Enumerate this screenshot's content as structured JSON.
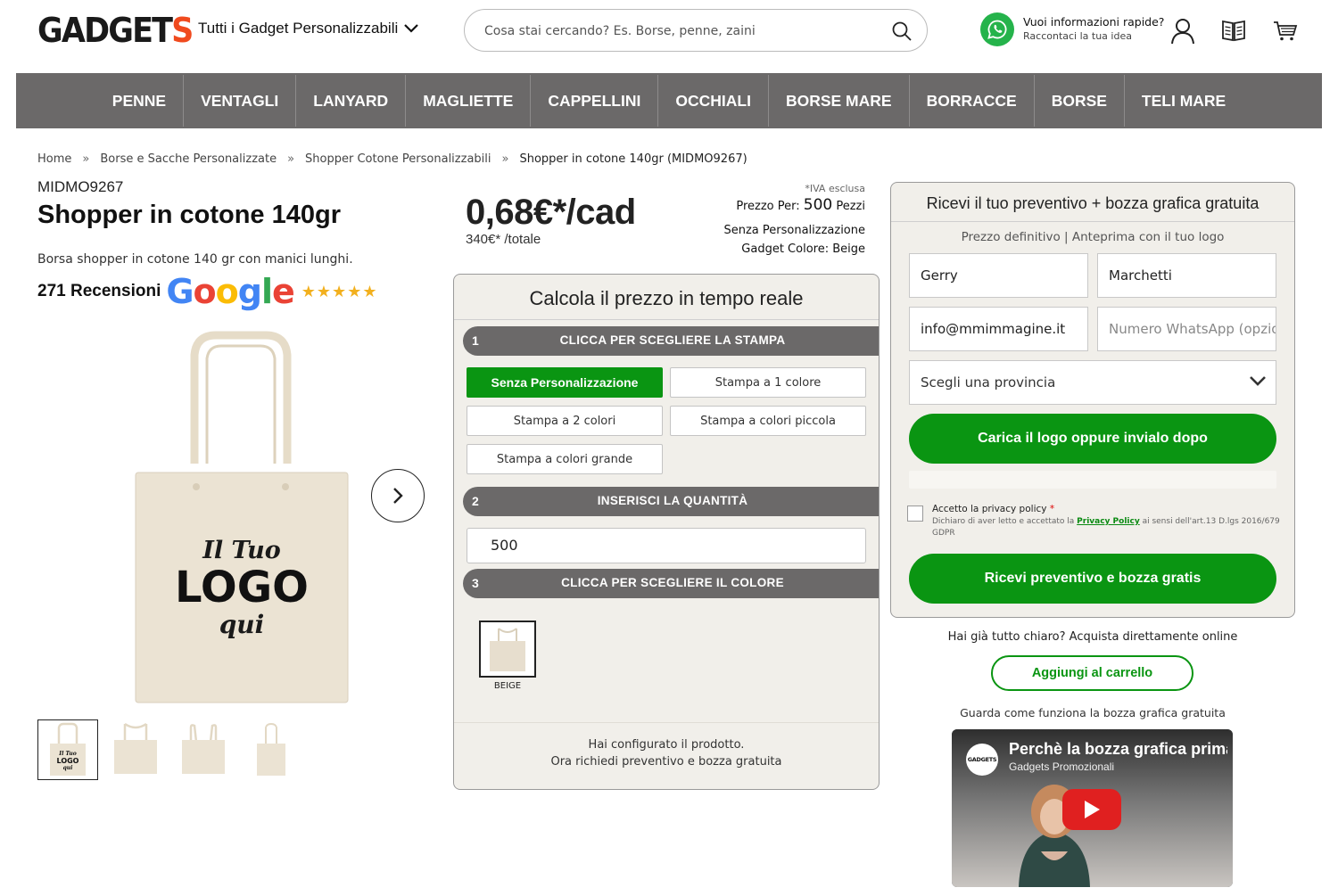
{
  "header": {
    "logo_main": "GADGET",
    "logo_accent": "S",
    "categories_label": "Tutti i Gadget Personalizzabili",
    "search_placeholder": "Cosa stai cercando? Es. Borse, penne, zaini",
    "whatsapp_title": "Vuoi informazioni rapide?",
    "whatsapp_sub": "Raccontaci la tua idea",
    "icons": [
      "chevron-down-icon",
      "search-icon",
      "whatsapp-icon",
      "user-icon",
      "catalog-icon",
      "cart-icon"
    ]
  },
  "nav": [
    "PENNE",
    "VENTAGLI",
    "LANYARD",
    "MAGLIETTE",
    "CAPPELLINI",
    "OCCHIALI",
    "BORSE MARE",
    "BORRACCE",
    "BORSE",
    "TELI MARE"
  ],
  "breadcrumb": {
    "items": [
      "Home",
      "Borse e Sacche Personalizzate",
      "Shopper Cotone Personalizzabili",
      "Shopper in cotone 140gr (MIDMO9267)"
    ],
    "separator": "»"
  },
  "product": {
    "sku": "MIDMO9267",
    "title": "Shopper in cotone 140gr",
    "description": "Borsa shopper in cotone 140 gr con manici lunghi.",
    "reviews": "271 Recensioni",
    "google_letters": [
      "G",
      "o",
      "o",
      "g",
      "l",
      "e"
    ],
    "stars": "★★★★★",
    "rating_stars": 5,
    "logo_text": [
      "Il Tuo",
      "LOGO",
      "qui"
    ],
    "thumbnail_count": 4
  },
  "price": {
    "unit": "0,68€*/cad",
    "total": "340€* /totale",
    "iva": "*IVA esclusa",
    "per_label": "Prezzo Per:",
    "per_qty": "500",
    "per_unit": "Pezzi",
    "personalization": "Senza Personalizzazione",
    "color": "Gadget Colore: Beige"
  },
  "calculator": {
    "title": "Calcola il prezzo in tempo reale",
    "step1": {
      "num": "1",
      "label": "CLICCA PER SCEGLIERE LA STAMPA"
    },
    "options": [
      "Senza Personalizzazione",
      "Stampa a 1 colore",
      "Stampa a 2 colori",
      "Stampa a colori piccola",
      "Stampa a colori grande"
    ],
    "selected_option": "Senza Personalizzazione",
    "step2": {
      "num": "2",
      "label": "INSERISCI LA QUANTITÀ"
    },
    "quantity": "500",
    "step3": {
      "num": "3",
      "label": "CLICCA PER SCEGLIERE IL COLORE"
    },
    "color_label": "BEIGE",
    "footer_line1": "Hai configurato il prodotto.",
    "footer_line2": "Ora richiedi preventivo e bozza gratuita"
  },
  "form": {
    "title": "Ricevi il tuo preventivo + bozza grafica gratuita",
    "subtitle": "Prezzo definitivo | Anteprima con il tuo logo",
    "first_name": "Gerry",
    "last_name": "Marchetti",
    "email": "info@mmimmagine.it",
    "whatsapp_placeholder": "Numero WhatsApp (opzionale)",
    "province_placeholder": "Scegli una provincia",
    "upload_button": "Carica il logo oppure invialo dopo",
    "privacy_label": "Accetto la privacy policy",
    "privacy_required": "*",
    "privacy_text_pre": "Dichiaro di aver letto e accettato la",
    "privacy_link": "Privacy Policy",
    "privacy_text_post": "ai sensi dell'art.13 D.lgs 2016/679 GDPR",
    "submit_button": "Ricevi preventivo e bozza gratis"
  },
  "buy": {
    "already": "Hai già tutto chiaro? Acquista direttamente online",
    "cart_button": "Aggiungi al carrello",
    "video_hint": "Guarda come funziona la bozza grafica gratuita"
  },
  "video": {
    "title": "Perchè la bozza grafica prima",
    "channel": "Gadgets Promozionali",
    "avatar_text": "GADGETS"
  },
  "colors": {
    "brand_accent": "#f04a1e",
    "nav_bg": "#6b6969",
    "green": "#0a9512",
    "panel_bg": "#f1efea",
    "bag_beige": "#ebe3d3"
  }
}
